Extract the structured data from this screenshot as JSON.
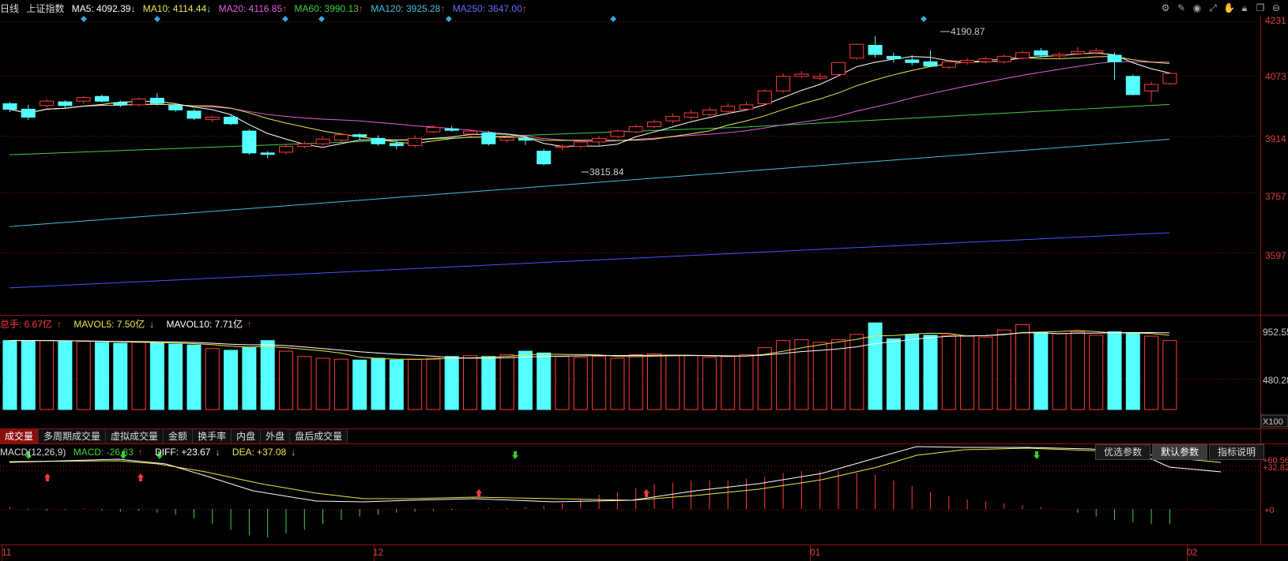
{
  "main_legend": {
    "period": "日线",
    "name": "上证指数",
    "ma5": {
      "label": "MA5: 4092.39",
      "arrow": "↓",
      "color": "#ffffff"
    },
    "ma10": {
      "label": "MA10: 4114.44",
      "arrow": "↓",
      "color": "#e8e84a"
    },
    "ma20": {
      "label": "MA20: 4116.85",
      "arrow": "↑",
      "color": "#e060e0"
    },
    "ma60": {
      "label": "MA60: 3990.13",
      "arrow": "↑",
      "color": "#40d040"
    },
    "ma120": {
      "label": "MA120: 3925.28",
      "arrow": "↑",
      "color": "#40c0e0"
    },
    "ma250": {
      "label": "MA250: 3647.00",
      "arrow": "↑",
      "color": "#5050ff"
    }
  },
  "price_axis": [
    "4231",
    "4073",
    "3914",
    "3757",
    "3597"
  ],
  "high_label": "4190.87",
  "low_label": "3815.84",
  "vol_legend": {
    "total": "总手: 6.67亿",
    "total_arrow": "↑",
    "mavol5": "MAVOL5: 7.50亿",
    "mavol5_arrow": "↓",
    "mavol10": "MAVOL10: 7.71亿",
    "mavol10_arrow": "↑"
  },
  "vol_axis": [
    "952.55",
    "480.28"
  ],
  "vol_unit": "X100",
  "tabs": [
    "成交量",
    "多周期成交量",
    "虚拟成交量",
    "金额",
    "换手率",
    "内盘",
    "外盘",
    "盘后成交量"
  ],
  "macd_legend": {
    "name": "MACD(12,26,9)",
    "macd": "MACD: -26.83",
    "macd_arrow": "↑",
    "diff": "DIFF: +23.67",
    "diff_arrow": "↓",
    "dea": "DEA: +37.08",
    "dea_arrow": "↓"
  },
  "param_buttons": [
    "优选参数",
    "默认参数",
    "指标说明"
  ],
  "macd_axis": [
    "+60.56",
    "+32.82",
    "+0"
  ],
  "date_axis": [
    "11",
    "12",
    "01",
    "02"
  ],
  "icons": [
    "settings-icon",
    "pen-icon",
    "eye-icon",
    "fullscreen-icon",
    "hand-icon",
    "lock-icon",
    "copy-icon",
    "prev-icon"
  ],
  "colors": {
    "up": "#ff3b3b",
    "down": "#54ffff",
    "grid": "#8a1212"
  }
}
